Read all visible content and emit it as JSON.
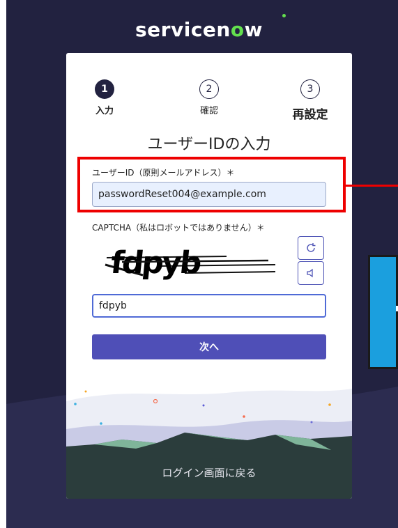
{
  "brand": {
    "logo_prefix": "servicen",
    "logo_o": "o",
    "logo_suffix": "w"
  },
  "steps": [
    {
      "number": "1",
      "label": "入力"
    },
    {
      "number": "2",
      "label": "確認"
    },
    {
      "number": "3",
      "label": "再設定"
    }
  ],
  "form": {
    "title": "ユーザーIDの入力",
    "userid_label": "ユーザーID（原則メールアドレス）＊",
    "userid_value": "passwordReset004@example.com",
    "captcha_label": "CAPTCHA（私はロボットではありません）＊",
    "captcha_text": "fdpyb",
    "captcha_value": "fdpyb",
    "next_label": "次へ"
  },
  "footer": {
    "back_link": "ログイン画面に戻る"
  },
  "colors": {
    "background": "#222240",
    "primary_button": "#4f4fb7",
    "brand_green": "#63df4e",
    "highlight": "#ee0000",
    "side_panel": "#1b9fde"
  }
}
